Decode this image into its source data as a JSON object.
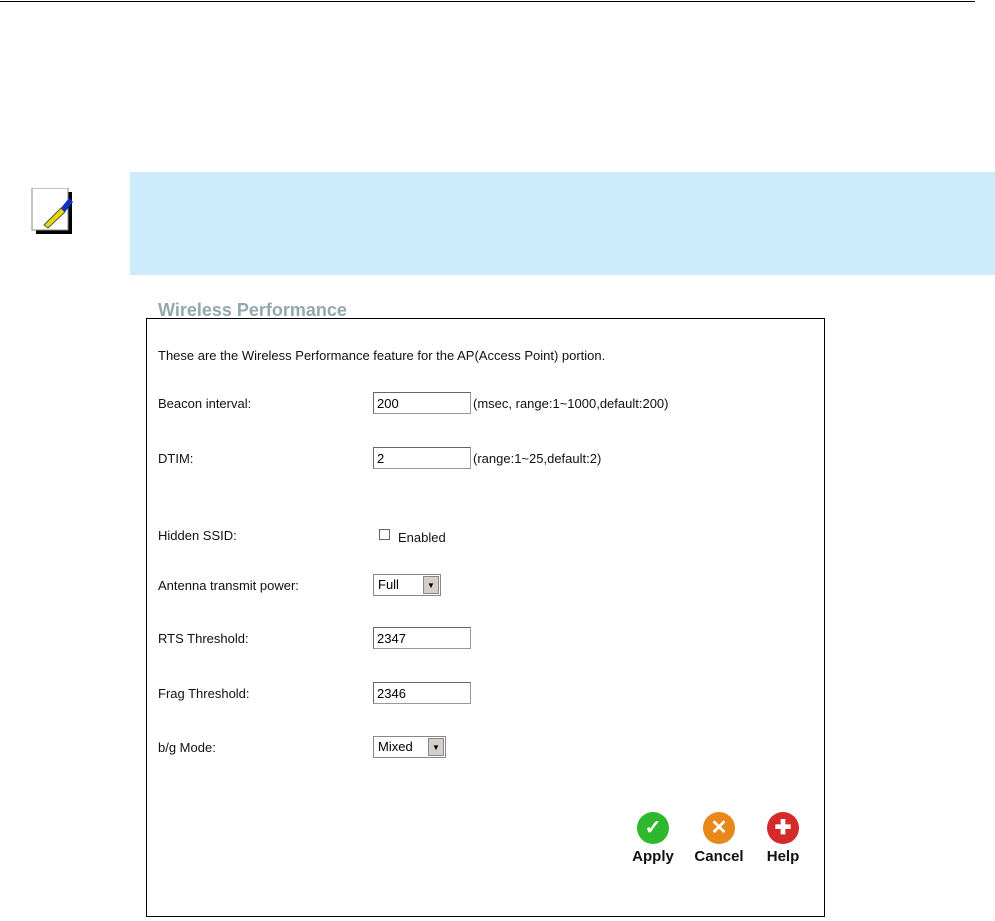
{
  "form": {
    "title": "Wireless Performance",
    "description": "These are the Wireless Performance feature for the AP(Access Point) portion.",
    "beacon": {
      "label": "Beacon interval:",
      "value": "200",
      "hint": "(msec, range:1~1000,default:200)"
    },
    "dtim": {
      "label": "DTIM:",
      "value": "2",
      "hint": "(range:1~25,default:2)"
    },
    "hidden_ssid": {
      "label": "Hidden SSID:",
      "checkbox_label": "Enabled"
    },
    "antenna": {
      "label": "Antenna transmit power:",
      "value": "Full"
    },
    "rts": {
      "label": "RTS Threshold:",
      "value": "2347"
    },
    "frag": {
      "label": "Frag Threshold:",
      "value": "2346"
    },
    "bg_mode": {
      "label": "b/g Mode:",
      "value": "Mixed"
    }
  },
  "buttons": {
    "apply": "Apply",
    "cancel": "Cancel",
    "help": "Help"
  },
  "colors": {
    "note_bg": "#cdebfd",
    "title": "#93a8ad",
    "apply": "#2eb82e",
    "cancel": "#e8881a",
    "help": "#d42a2a"
  }
}
